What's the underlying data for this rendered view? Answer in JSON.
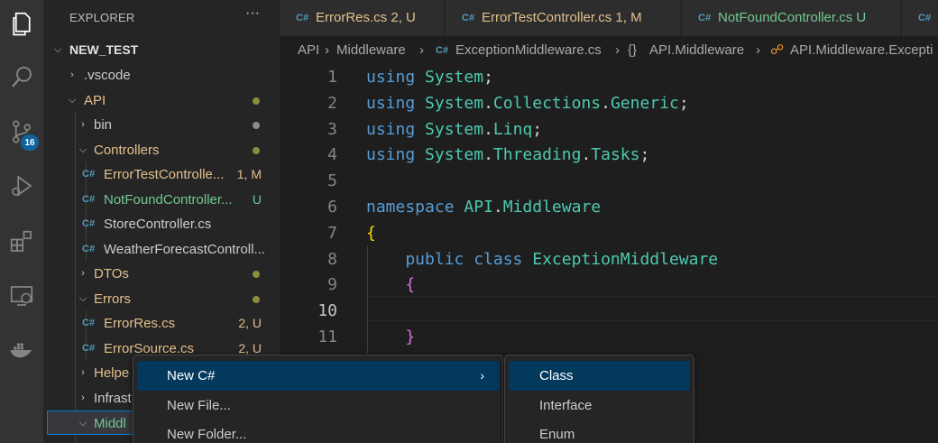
{
  "activity_bar": {
    "items": [
      "explorer-icon",
      "search-icon",
      "source-control-icon",
      "run-debug-icon",
      "extensions-icon",
      "remote-explorer-icon",
      "docker-icon"
    ],
    "source_control_badge": "16"
  },
  "sidebar": {
    "title": "EXPLORER",
    "more": "···",
    "root": "NEW_TEST",
    "tree": [
      {
        "label": ".vscode",
        "decoration": ""
      },
      {
        "label": "API",
        "decoration": ""
      },
      {
        "label": "bin",
        "decoration": ""
      },
      {
        "label": "Controllers",
        "decoration": ""
      },
      {
        "label": "ErrorTestControlle...",
        "decoration": "1, M"
      },
      {
        "label": "NotFoundController...",
        "decoration": "U"
      },
      {
        "label": "StoreController.cs",
        "decoration": ""
      },
      {
        "label": "WeatherForecastControll...",
        "decoration": ""
      },
      {
        "label": "DTOs",
        "decoration": ""
      },
      {
        "label": "Errors",
        "decoration": ""
      },
      {
        "label": "ErrorRes.cs",
        "decoration": "2, U"
      },
      {
        "label": "ErrorSource.cs",
        "decoration": "2, U"
      },
      {
        "label": "Helpe",
        "decoration": ""
      },
      {
        "label": "Infrast",
        "decoration": ""
      },
      {
        "label": "Middl",
        "decoration": ""
      }
    ],
    "cs_icon": "C#"
  },
  "tabs": [
    {
      "label": "ErrorRes.cs",
      "decoration": "2, U"
    },
    {
      "label": "ErrorTestController.cs",
      "decoration": "1, M"
    },
    {
      "label": "NotFoundController.cs",
      "decoration": "U"
    }
  ],
  "breadcrumb": {
    "items": [
      "API",
      "Middleware",
      "ExceptionMiddleware.cs",
      "API.Middleware",
      "API.Middleware.Excepti"
    ],
    "sep": "›",
    "ns_symbol": "{}"
  },
  "editor": {
    "line_numbers": [
      "1",
      "2",
      "3",
      "4",
      "5",
      "6",
      "7",
      "8",
      "9",
      "10",
      "11"
    ],
    "active_line": "10",
    "lines": [
      {
        "kw": "using",
        "rest": [
          [
            "ns",
            "System"
          ],
          [
            "pl",
            ";"
          ]
        ]
      },
      {
        "kw": "using",
        "rest": [
          [
            "ns",
            "System"
          ],
          [
            "pl",
            "."
          ],
          [
            "ns",
            "Collections"
          ],
          [
            "pl",
            "."
          ],
          [
            "ns",
            "Generic"
          ],
          [
            "pl",
            ";"
          ]
        ]
      },
      {
        "kw": "using",
        "rest": [
          [
            "ns",
            "System"
          ],
          [
            "pl",
            "."
          ],
          [
            "ns",
            "Linq"
          ],
          [
            "pl",
            ";"
          ]
        ]
      },
      {
        "kw": "using",
        "rest": [
          [
            "ns",
            "System"
          ],
          [
            "pl",
            "."
          ],
          [
            "ns",
            "Threading"
          ],
          [
            "pl",
            "."
          ],
          [
            "ns",
            "Tasks"
          ],
          [
            "pl",
            ";"
          ]
        ]
      },
      {
        "kw": "",
        "rest": []
      },
      {
        "kw": "namespace",
        "rest": [
          [
            "ns",
            "API"
          ],
          [
            "pl",
            "."
          ],
          [
            "ns",
            "Middleware"
          ]
        ]
      },
      {
        "kw": "",
        "rest": [
          [
            "br1",
            "{"
          ]
        ]
      },
      {
        "kw": "    public class",
        "rest": [
          [
            "ns",
            "ExceptionMiddleware"
          ]
        ]
      },
      {
        "kw": "",
        "rest": [
          [
            "br2",
            "    {"
          ]
        ]
      },
      {
        "kw": "",
        "rest": []
      },
      {
        "kw": "",
        "rest": [
          [
            "br2",
            "    }"
          ]
        ]
      }
    ]
  },
  "context_menu": {
    "items": [
      "New C#",
      "New File...",
      "New Folder..."
    ],
    "submenu_arrow": "›"
  },
  "submenu": {
    "items": [
      "Class",
      "Interface",
      "Enum"
    ]
  },
  "colors": {
    "accent": "#007fd4",
    "menu_highlight": "#04395e",
    "modified": "#e2c08d",
    "untracked": "#73c991",
    "csharp": "#519aba"
  }
}
